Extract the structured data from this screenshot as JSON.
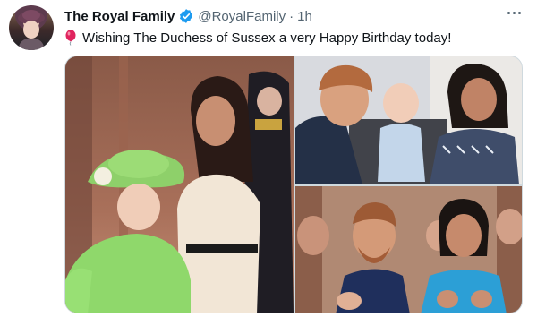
{
  "tweet": {
    "display_name": "The Royal Family",
    "handle": "@RoyalFamily",
    "separator": "·",
    "time": "1h",
    "text": "Wishing The Duchess of Sussex a very Happy Birthday today!",
    "emoji_icon": "balloon-icon",
    "verified_icon": "verified-badge-icon",
    "more_icon": "more-options-icon"
  },
  "media": {
    "photos": [
      {
        "name": "photo-queen-and-duchess"
      },
      {
        "name": "photo-family-with-baby"
      },
      {
        "name": "photo-couple-clapping"
      }
    ]
  },
  "colors": {
    "verified_blue": "#1d9bf0",
    "text_primary": "#0f1419",
    "text_secondary": "#536471",
    "border": "#cfd9de",
    "balloon_red": "#e0245e"
  }
}
